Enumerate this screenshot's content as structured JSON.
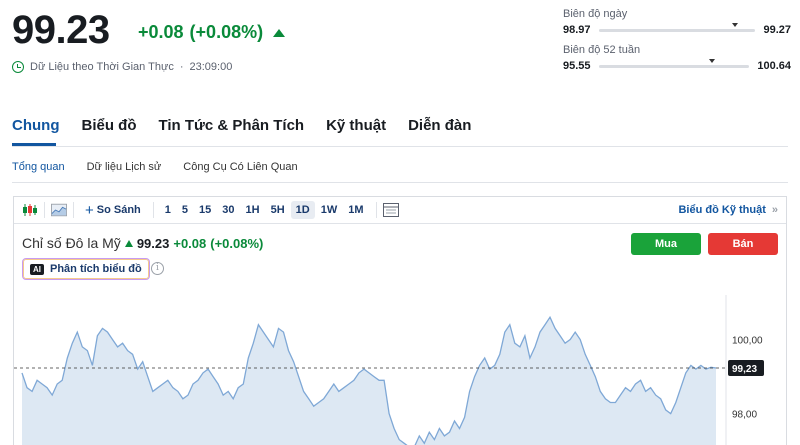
{
  "header": {
    "price": "99.23",
    "change": "+0.08",
    "change_pct": "(+0.08%)",
    "realtime_label": "Dữ Liệu theo Thời Gian Thực",
    "time": "23:09:00"
  },
  "ranges": {
    "day": {
      "label": "Biên độ ngày",
      "low": "98.97",
      "high": "99.27",
      "marker_fraction": 0.87
    },
    "week52": {
      "label": "Biên độ 52 tuần",
      "low": "95.55",
      "high": "100.64",
      "marker_fraction": 0.75
    }
  },
  "tabs": [
    "Chung",
    "Biểu đồ",
    "Tin Tức & Phân Tích",
    "Kỹ thuật",
    "Diễn đàn"
  ],
  "subtabs": [
    "Tổng quan",
    "Dữ liệu Lịch sử",
    "Công Cụ Có Liên Quan"
  ],
  "toolbar": {
    "compare_label": "So Sánh",
    "timeframes": [
      "1",
      "5",
      "15",
      "30",
      "1H",
      "5H",
      "1D",
      "1W",
      "1M"
    ],
    "selected": "1D",
    "tech_chart_label": "Biểu đồ Kỹ thuật",
    "tech_chart_arrow": "»"
  },
  "chart_header": {
    "name": "Chỉ số Đô la Mỹ",
    "value": "99.23",
    "change": "+0.08",
    "change_pct": "(+0.08%)",
    "ai_badge": "AI",
    "ai_label": "Phân tích biểu đồ",
    "info": "i",
    "buy_label": "Mua",
    "sell_label": "Bán"
  },
  "colors": {
    "positive": "#0a8a3a",
    "link": "#1256a0",
    "buy": "#1aa33a",
    "sell": "#e53935",
    "line": "#7fa8d6",
    "area": "#dde8f3"
  },
  "chart_data": {
    "type": "area",
    "ylabels": [
      "100,00",
      "98,00"
    ],
    "y_ticks": [
      100.0,
      98.0
    ],
    "last_value_label": "99,23",
    "last_value": 99.23,
    "ylim": [
      97.1,
      101.2
    ],
    "grid": false,
    "values": [
      99.1,
      98.7,
      98.6,
      98.9,
      98.8,
      98.7,
      98.5,
      98.8,
      98.9,
      99.5,
      99.9,
      100.2,
      99.8,
      99.7,
      99.3,
      100.1,
      100.3,
      100.2,
      100.0,
      99.8,
      99.9,
      99.7,
      99.6,
      99.2,
      99.4,
      99.0,
      98.6,
      98.7,
      98.8,
      98.9,
      98.7,
      98.6,
      98.4,
      98.5,
      98.8,
      98.9,
      99.1,
      99.2,
      99.0,
      98.8,
      98.5,
      98.6,
      98.4,
      98.7,
      98.8,
      99.5,
      99.9,
      100.4,
      100.2,
      100.0,
      99.8,
      100.3,
      100.2,
      99.7,
      99.4,
      99.0,
      98.6,
      98.4,
      98.2,
      98.3,
      98.4,
      98.6,
      98.8,
      98.6,
      98.7,
      98.8,
      98.9,
      99.1,
      99.2,
      99.1,
      99.0,
      98.9,
      98.9,
      98.0,
      97.6,
      97.3,
      97.2,
      97.1,
      97.1,
      97.4,
      97.2,
      97.5,
      97.3,
      97.6,
      97.4,
      97.5,
      97.8,
      97.6,
      97.9,
      98.6,
      99.0,
      99.3,
      99.5,
      99.2,
      99.3,
      99.6,
      100.2,
      100.4,
      99.9,
      99.8,
      100.1,
      99.5,
      99.8,
      100.2,
      100.4,
      100.6,
      100.3,
      100.1,
      99.9,
      100.0,
      100.2,
      100.0,
      99.6,
      99.3,
      99.0,
      98.6,
      98.4,
      98.3,
      98.3,
      98.5,
      98.7,
      98.6,
      98.8,
      98.9,
      98.6,
      98.7,
      98.5,
      98.4,
      98.1,
      98.0,
      98.3,
      98.7,
      99.1,
      99.3,
      99.2,
      99.3,
      99.2,
      99.25,
      99.23
    ]
  }
}
